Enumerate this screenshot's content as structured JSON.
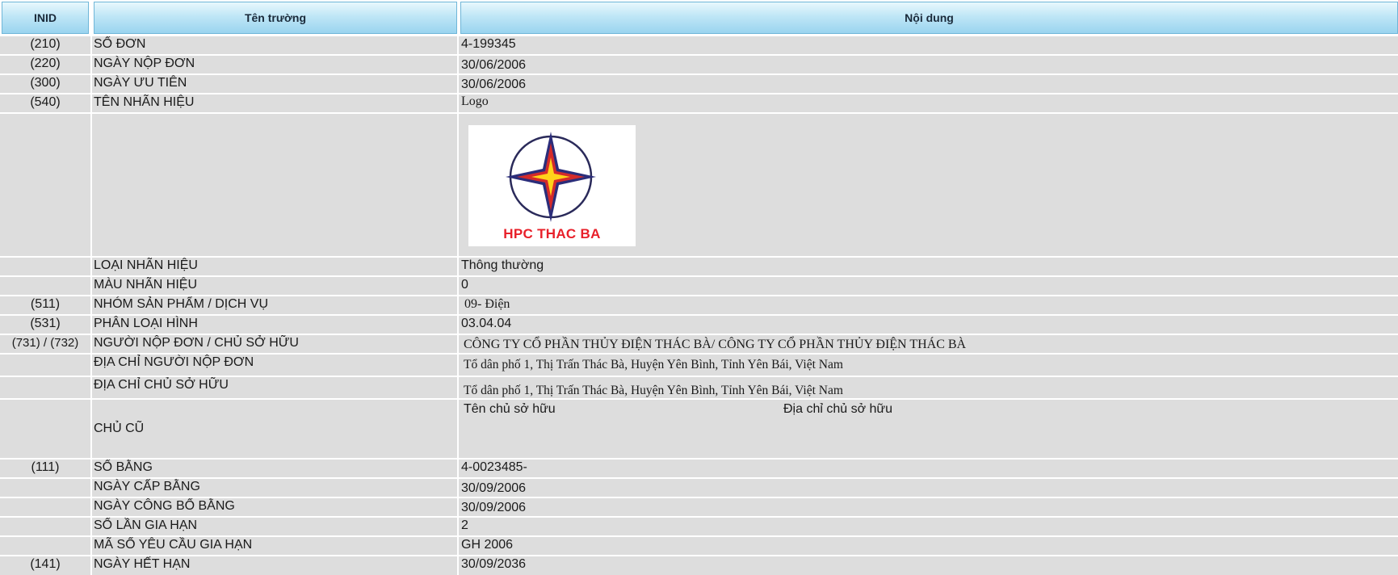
{
  "header": {
    "inid": "INID",
    "field": "Tên trường",
    "content": "Nội dung"
  },
  "rows": [
    {
      "inid": "(210)",
      "field": "SỐ ĐƠN",
      "value": "4-199345"
    },
    {
      "inid": "(220)",
      "field": "NGÀY NỘP ĐƠN",
      "value": "30/06/2006"
    },
    {
      "inid": "(300)",
      "field": "NGÀY ƯU TIÊN",
      "value": "30/06/2006"
    },
    {
      "inid": "(540)",
      "field": "TÊN NHÃN HIỆU",
      "value": "Logo"
    },
    {
      "inid": "",
      "field": "LOẠI NHÃN HIỆU",
      "value": "Thông thường"
    },
    {
      "inid": "",
      "field": "MÀU NHÃN HIỆU",
      "value": "0"
    },
    {
      "inid": "(511)",
      "field": "NHÓM SẢN PHẨM / DỊCH VỤ",
      "value": "09- Điện"
    },
    {
      "inid": "(531)",
      "field": "PHÂN LOẠI HÌNH",
      "value": "03.04.04"
    },
    {
      "inid": "(731) / (732)",
      "field": "NGƯỜI NỘP ĐƠN / CHỦ SỞ HỮU",
      "value": "CÔNG TY CỔ PHẦN THỦY ĐIỆN THÁC BÀ/ CÔNG TY CỔ PHẦN THỦY ĐIỆN THÁC BÀ"
    },
    {
      "inid": "",
      "field": "ĐỊA CHỈ NGƯỜI NỘP ĐƠN",
      "value": "Tổ dân phố 1, Thị Trấn Thác Bà, Huyện Yên Bình, Tỉnh Yên Bái, Việt Nam"
    },
    {
      "inid": "",
      "field": "ĐỊA CHỈ CHỦ SỞ HỮU",
      "value": "Tổ dân phố 1, Thị Trấn Thác Bà, Huyện Yên Bình, Tỉnh Yên Bái, Việt Nam"
    },
    {
      "inid": "",
      "field": "CHỦ CŨ",
      "value_a": "Tên chủ sở hữu",
      "value_b": "Địa chỉ chủ sở hữu"
    },
    {
      "inid": "(111)",
      "field": "SỐ BẰNG",
      "value": "4-0023485-"
    },
    {
      "inid": "",
      "field": "NGÀY CẤP BẰNG",
      "value": "30/09/2006"
    },
    {
      "inid": "",
      "field": "NGÀY CÔNG BỐ BẰNG",
      "value": "30/09/2006"
    },
    {
      "inid": "",
      "field": "SỐ LẦN GIA HẠN",
      "value": "2"
    },
    {
      "inid": "",
      "field": "MÃ SỐ YÊU CẦU GIA HẠN",
      "value": "GH 2006"
    },
    {
      "inid": "(141)",
      "field": "NGÀY HẾT HẠN",
      "value": "30/09/2036"
    }
  ],
  "logo": {
    "text": "HPC THAC BA",
    "icon": "compass-star-icon",
    "ring_color": "#2a2a5a",
    "star_outer": "#2b2d7a",
    "star_mid": "#d42a2a",
    "star_core": "#ffd21a",
    "text_color": "#e8202a"
  }
}
